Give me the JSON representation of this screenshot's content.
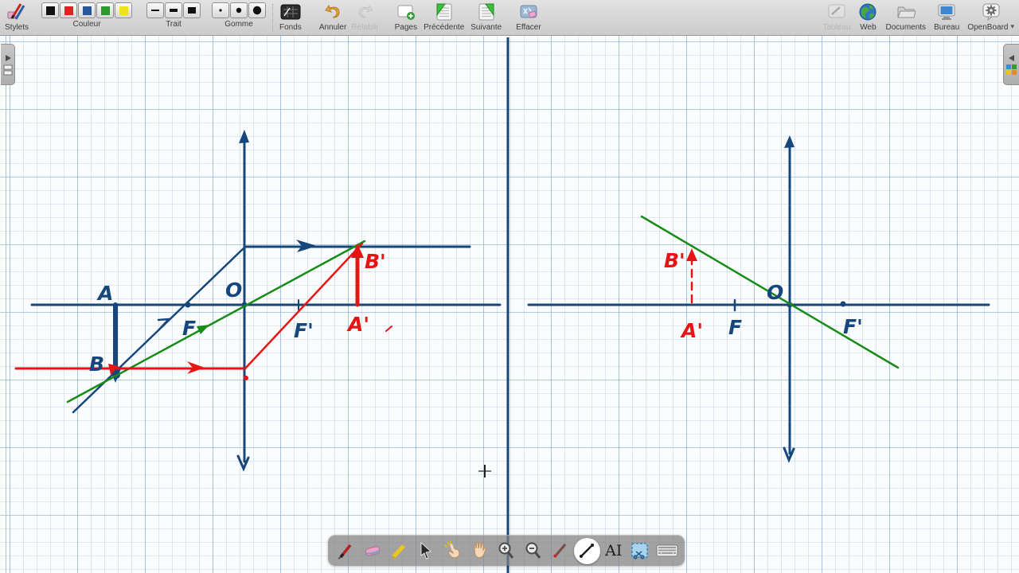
{
  "toolbar": {
    "stylets": {
      "label": "Stylets"
    },
    "couleur": {
      "label": "Couleur",
      "swatches": [
        "#111111",
        "#e02121",
        "#27569b",
        "#2a9a2a",
        "#efe11f"
      ],
      "selected_index": 3
    },
    "trait": {
      "label": "Trait"
    },
    "gomme": {
      "label": "Gomme"
    },
    "fonds": {
      "label": "Fonds"
    },
    "annuler": {
      "label": "Annuler"
    },
    "retablir": {
      "label": "Rétablir"
    },
    "pages": {
      "label": "Pages"
    },
    "precedente": {
      "label": "Précédente"
    },
    "suivante": {
      "label": "Suivante"
    },
    "effacer": {
      "label": "Effacer"
    },
    "tableau": {
      "label": "Tableau"
    },
    "web": {
      "label": "Web"
    },
    "documents": {
      "label": "Documents"
    },
    "bureau": {
      "label": "Bureau"
    },
    "openboard": {
      "label": "OpenBoard",
      "caret": "▾"
    }
  },
  "palette": {
    "text_tool_label": "AI",
    "selected_tool": "line",
    "tools": [
      "pen",
      "eraser",
      "marker",
      "selector",
      "interact",
      "hand",
      "zoom-in",
      "zoom-out",
      "laser",
      "line",
      "text",
      "capture",
      "keyboard"
    ]
  },
  "board": {
    "ink_colors": {
      "blue": "#16477c",
      "red": "#e81414",
      "green": "#188c18"
    },
    "left_diagram": {
      "A": "A",
      "B": "B",
      "O": "O",
      "F": "F",
      "F_prime": "F'",
      "A_prime": "A'",
      "B_prime": "B'"
    },
    "right_diagram": {
      "O": "O",
      "F": "F",
      "F_prime": "F'",
      "A_prime": "A'",
      "B_prime": "B'"
    }
  }
}
